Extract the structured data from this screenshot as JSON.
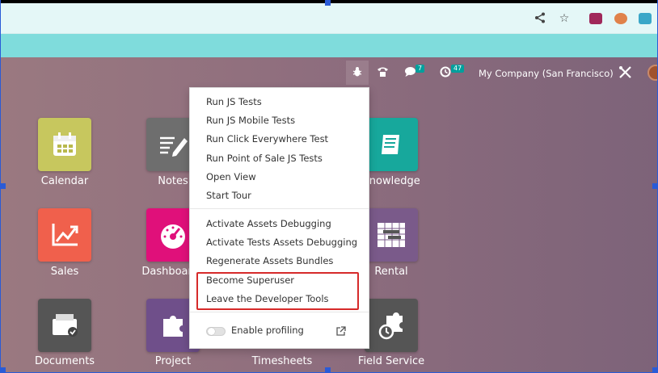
{
  "browser": {
    "icons": [
      "share-icon",
      "star-icon"
    ],
    "extension_colors": [
      "#a0285a",
      "#e0824a",
      "#3aa7c8"
    ]
  },
  "navbar": {
    "chat_count": "7",
    "activity_count": "47",
    "company": "My Company (San Francisco)"
  },
  "apps": [
    {
      "label": "Calendar"
    },
    {
      "label": "Notes"
    },
    {
      "label": "Knowledge"
    },
    {
      "label": "Sales"
    },
    {
      "label": "Dashboards"
    },
    {
      "label": "Rental"
    },
    {
      "label": "Documents"
    },
    {
      "label": "Project"
    },
    {
      "label": "Timesheets"
    },
    {
      "label": "Field Service"
    }
  ],
  "debug_menu": {
    "run_js_tests": "Run JS Tests",
    "run_js_mobile_tests": "Run JS Mobile Tests",
    "run_click_everywhere": "Run Click Everywhere Test",
    "run_pos_tests": "Run Point of Sale JS Tests",
    "open_view": "Open View",
    "start_tour": "Start Tour",
    "activate_assets_debugging": "Activate Assets Debugging",
    "activate_tests_assets_debugging": "Activate Tests Assets Debugging",
    "regenerate_assets": "Regenerate Assets Bundles",
    "become_superuser": "Become Superuser",
    "leave_dev_tools": "Leave the Developer Tools",
    "enable_profiling": "Enable profiling"
  },
  "colors": {
    "accent": "#00a09d",
    "highlight": "#d62a2a"
  }
}
